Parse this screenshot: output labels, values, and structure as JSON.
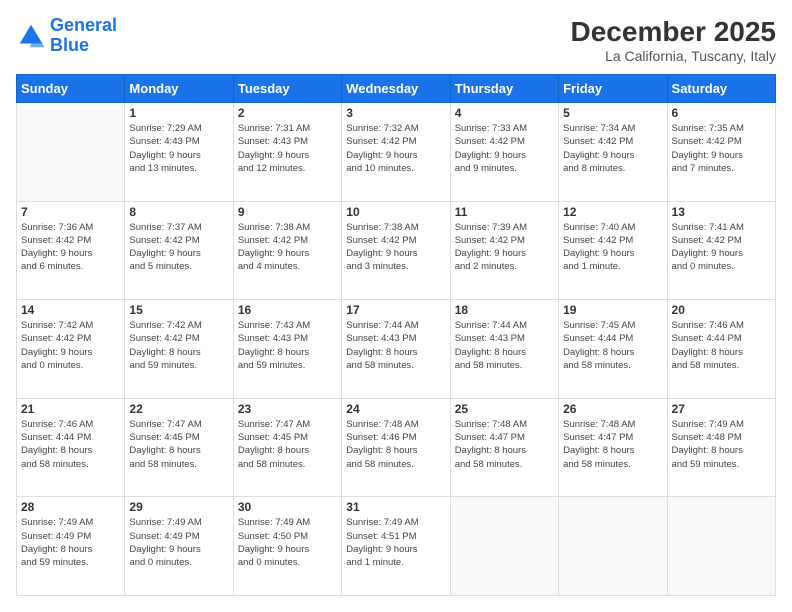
{
  "logo": {
    "line1": "General",
    "line2": "Blue"
  },
  "title": "December 2025",
  "subtitle": "La California, Tuscany, Italy",
  "weekdays": [
    "Sunday",
    "Monday",
    "Tuesday",
    "Wednesday",
    "Thursday",
    "Friday",
    "Saturday"
  ],
  "weeks": [
    [
      {
        "day": "",
        "info": ""
      },
      {
        "day": "1",
        "info": "Sunrise: 7:29 AM\nSunset: 4:43 PM\nDaylight: 9 hours\nand 13 minutes."
      },
      {
        "day": "2",
        "info": "Sunrise: 7:31 AM\nSunset: 4:43 PM\nDaylight: 9 hours\nand 12 minutes."
      },
      {
        "day": "3",
        "info": "Sunrise: 7:32 AM\nSunset: 4:42 PM\nDaylight: 9 hours\nand 10 minutes."
      },
      {
        "day": "4",
        "info": "Sunrise: 7:33 AM\nSunset: 4:42 PM\nDaylight: 9 hours\nand 9 minutes."
      },
      {
        "day": "5",
        "info": "Sunrise: 7:34 AM\nSunset: 4:42 PM\nDaylight: 9 hours\nand 8 minutes."
      },
      {
        "day": "6",
        "info": "Sunrise: 7:35 AM\nSunset: 4:42 PM\nDaylight: 9 hours\nand 7 minutes."
      }
    ],
    [
      {
        "day": "7",
        "info": "Sunrise: 7:36 AM\nSunset: 4:42 PM\nDaylight: 9 hours\nand 6 minutes."
      },
      {
        "day": "8",
        "info": "Sunrise: 7:37 AM\nSunset: 4:42 PM\nDaylight: 9 hours\nand 5 minutes."
      },
      {
        "day": "9",
        "info": "Sunrise: 7:38 AM\nSunset: 4:42 PM\nDaylight: 9 hours\nand 4 minutes."
      },
      {
        "day": "10",
        "info": "Sunrise: 7:38 AM\nSunset: 4:42 PM\nDaylight: 9 hours\nand 3 minutes."
      },
      {
        "day": "11",
        "info": "Sunrise: 7:39 AM\nSunset: 4:42 PM\nDaylight: 9 hours\nand 2 minutes."
      },
      {
        "day": "12",
        "info": "Sunrise: 7:40 AM\nSunset: 4:42 PM\nDaylight: 9 hours\nand 1 minute."
      },
      {
        "day": "13",
        "info": "Sunrise: 7:41 AM\nSunset: 4:42 PM\nDaylight: 9 hours\nand 0 minutes."
      }
    ],
    [
      {
        "day": "14",
        "info": "Sunrise: 7:42 AM\nSunset: 4:42 PM\nDaylight: 9 hours\nand 0 minutes."
      },
      {
        "day": "15",
        "info": "Sunrise: 7:42 AM\nSunset: 4:42 PM\nDaylight: 8 hours\nand 59 minutes."
      },
      {
        "day": "16",
        "info": "Sunrise: 7:43 AM\nSunset: 4:43 PM\nDaylight: 8 hours\nand 59 minutes."
      },
      {
        "day": "17",
        "info": "Sunrise: 7:44 AM\nSunset: 4:43 PM\nDaylight: 8 hours\nand 58 minutes."
      },
      {
        "day": "18",
        "info": "Sunrise: 7:44 AM\nSunset: 4:43 PM\nDaylight: 8 hours\nand 58 minutes."
      },
      {
        "day": "19",
        "info": "Sunrise: 7:45 AM\nSunset: 4:44 PM\nDaylight: 8 hours\nand 58 minutes."
      },
      {
        "day": "20",
        "info": "Sunrise: 7:46 AM\nSunset: 4:44 PM\nDaylight: 8 hours\nand 58 minutes."
      }
    ],
    [
      {
        "day": "21",
        "info": "Sunrise: 7:46 AM\nSunset: 4:44 PM\nDaylight: 8 hours\nand 58 minutes."
      },
      {
        "day": "22",
        "info": "Sunrise: 7:47 AM\nSunset: 4:45 PM\nDaylight: 8 hours\nand 58 minutes."
      },
      {
        "day": "23",
        "info": "Sunrise: 7:47 AM\nSunset: 4:45 PM\nDaylight: 8 hours\nand 58 minutes."
      },
      {
        "day": "24",
        "info": "Sunrise: 7:48 AM\nSunset: 4:46 PM\nDaylight: 8 hours\nand 58 minutes."
      },
      {
        "day": "25",
        "info": "Sunrise: 7:48 AM\nSunset: 4:47 PM\nDaylight: 8 hours\nand 58 minutes."
      },
      {
        "day": "26",
        "info": "Sunrise: 7:48 AM\nSunset: 4:47 PM\nDaylight: 8 hours\nand 58 minutes."
      },
      {
        "day": "27",
        "info": "Sunrise: 7:49 AM\nSunset: 4:48 PM\nDaylight: 8 hours\nand 59 minutes."
      }
    ],
    [
      {
        "day": "28",
        "info": "Sunrise: 7:49 AM\nSunset: 4:49 PM\nDaylight: 8 hours\nand 59 minutes."
      },
      {
        "day": "29",
        "info": "Sunrise: 7:49 AM\nSunset: 4:49 PM\nDaylight: 9 hours\nand 0 minutes."
      },
      {
        "day": "30",
        "info": "Sunrise: 7:49 AM\nSunset: 4:50 PM\nDaylight: 9 hours\nand 0 minutes."
      },
      {
        "day": "31",
        "info": "Sunrise: 7:49 AM\nSunset: 4:51 PM\nDaylight: 9 hours\nand 1 minute."
      },
      {
        "day": "",
        "info": ""
      },
      {
        "day": "",
        "info": ""
      },
      {
        "day": "",
        "info": ""
      }
    ]
  ]
}
